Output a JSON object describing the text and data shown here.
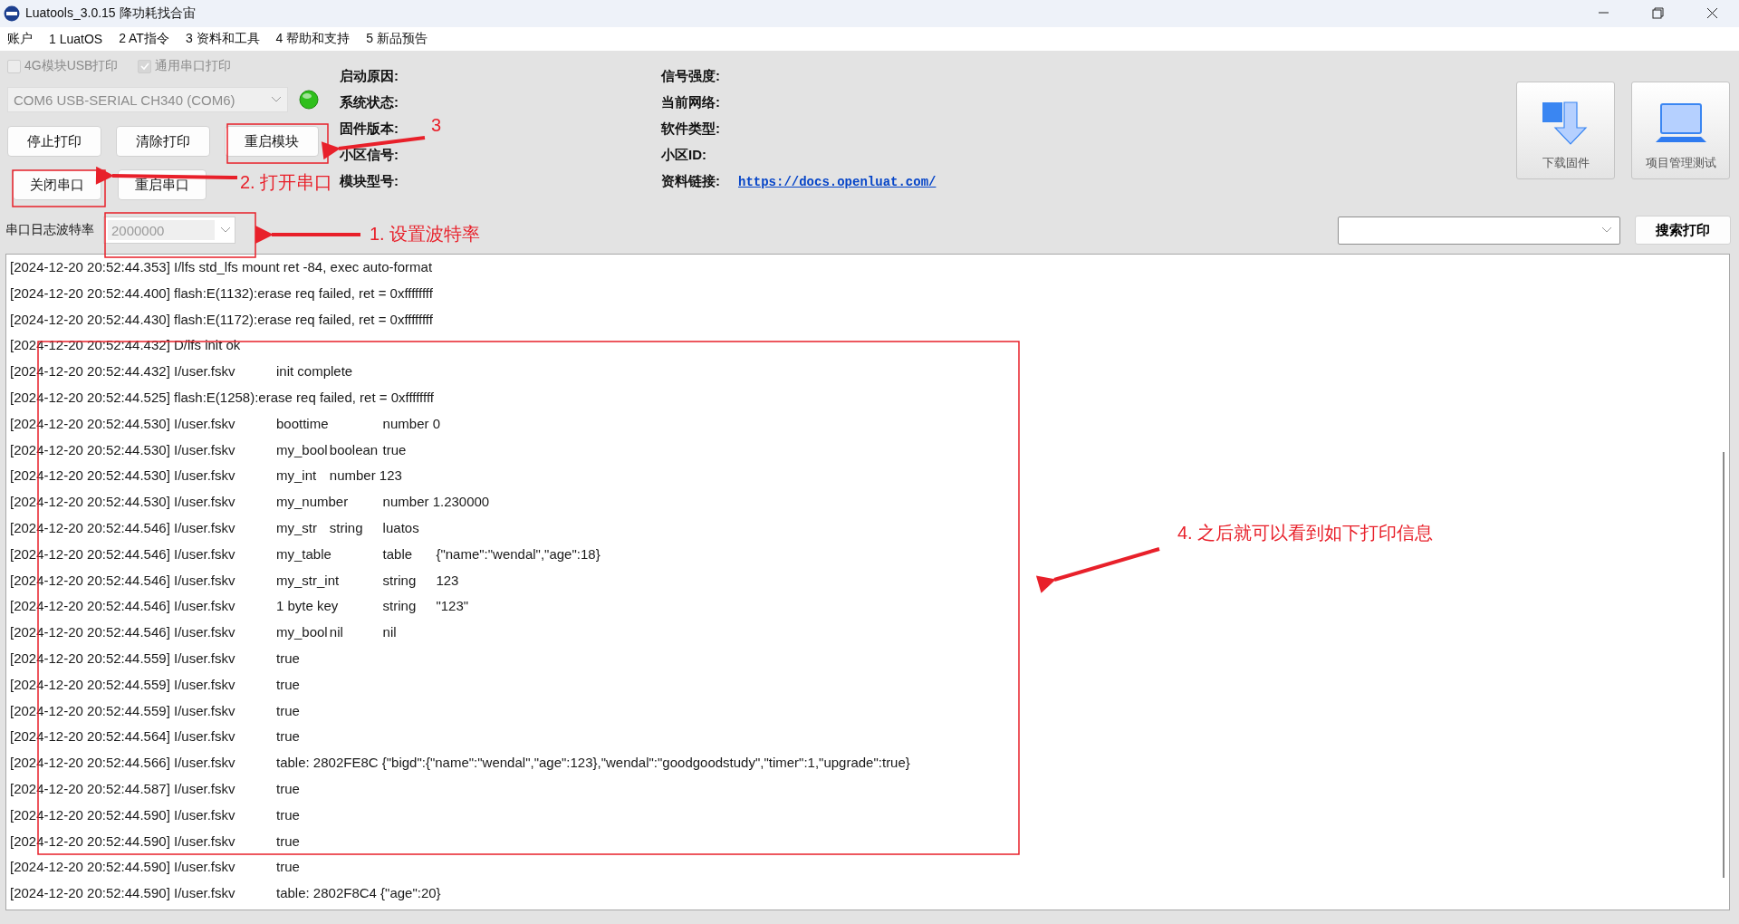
{
  "window": {
    "title": "Luatools_3.0.15 降功耗找合宙"
  },
  "menu": [
    "账户",
    "1 LuatOS",
    "2 AT指令",
    "3 资料和工具",
    "4 帮助和支持",
    "5 新品预告"
  ],
  "options": [
    {
      "label": "4G模块USB打印",
      "checked": false,
      "disabled": true
    },
    {
      "label": "通用串口打印",
      "checked": true,
      "disabled": true
    }
  ],
  "port_select": {
    "value": "COM6 USB-SERIAL CH340 (COM6)",
    "port_open": true
  },
  "buttons_row1": [
    "停止打印",
    "清除打印",
    "重启模块"
  ],
  "buttons_row2": [
    "关闭串口",
    "重启串口"
  ],
  "info_left": [
    "启动原因:",
    "系统状态:",
    "固件版本:",
    "小区信号:",
    "模块型号:"
  ],
  "info_right": [
    {
      "label": "信号强度:"
    },
    {
      "label": "当前网络:"
    },
    {
      "label": "软件类型:"
    },
    {
      "label": "小区ID:"
    },
    {
      "label": "资料链接:",
      "link": "https://docs.openluat.com/"
    }
  ],
  "tools": [
    {
      "label": "下载固件",
      "kind": "download"
    },
    {
      "label": "项目管理测试",
      "kind": "project"
    }
  ],
  "baud": {
    "label": "串口日志波特率",
    "value": "2000000"
  },
  "search": {
    "button": "搜索打印"
  },
  "log": [
    "[2024-12-20 20:52:44.353] I/lfs std_lfs mount ret -84, exec auto-format",
    "[2024-12-20 20:52:44.400] flash:E(1132):erase req failed, ret = 0xffffffff",
    "[2024-12-20 20:52:44.430] flash:E(1172):erase req failed, ret = 0xffffffff",
    "[2024-12-20 20:52:44.432] D/lfs init ok",
    "[2024-12-20 20:52:44.432] I/user.fskv\tinit complete",
    "[2024-12-20 20:52:44.525] flash:E(1258):erase req failed, ret = 0xffffffff",
    "[2024-12-20 20:52:44.530] I/user.fskv\tboottime\tnumber 0",
    "[2024-12-20 20:52:44.530] I/user.fskv\tmy_bool\tboolean\ttrue",
    "[2024-12-20 20:52:44.530] I/user.fskv\tmy_int\tnumber 123",
    "[2024-12-20 20:52:44.530] I/user.fskv\tmy_number\tnumber 1.230000",
    "[2024-12-20 20:52:44.546] I/user.fskv\tmy_str\tstring\tluatos",
    "[2024-12-20 20:52:44.546] I/user.fskv\tmy_table\ttable\t{\"name\":\"wendal\",\"age\":18}",
    "[2024-12-20 20:52:44.546] I/user.fskv\tmy_str_int\tstring\t123",
    "[2024-12-20 20:52:44.546] I/user.fskv\t1 byte key\tstring\t\"123\"",
    "[2024-12-20 20:52:44.546] I/user.fskv\tmy_bool\tnil\tnil",
    "[2024-12-20 20:52:44.559] I/user.fskv\ttrue",
    "[2024-12-20 20:52:44.559] I/user.fskv\ttrue",
    "[2024-12-20 20:52:44.559] I/user.fskv\ttrue",
    "[2024-12-20 20:52:44.564] I/user.fskv\ttrue",
    "[2024-12-20 20:52:44.566] I/user.fskv\ttable: 2802FE8C {\"bigd\":{\"name\":\"wendal\",\"age\":123},\"wendal\":\"goodgoodstudy\",\"timer\":1,\"upgrade\":true}",
    "[2024-12-20 20:52:44.587] I/user.fskv\ttrue",
    "[2024-12-20 20:52:44.590] I/user.fskv\ttrue",
    "[2024-12-20 20:52:44.590] I/user.fskv\ttrue",
    "[2024-12-20 20:52:44.590] I/user.fskv\ttrue",
    "[2024-12-20 20:52:44.590] I/user.fskv\ttable: 2802F8C4 {\"age\":20}"
  ],
  "annotations": [
    "3",
    "2. 打开串口",
    "1. 设置波特率",
    "4. 之后就可以看到如下打印信息"
  ]
}
